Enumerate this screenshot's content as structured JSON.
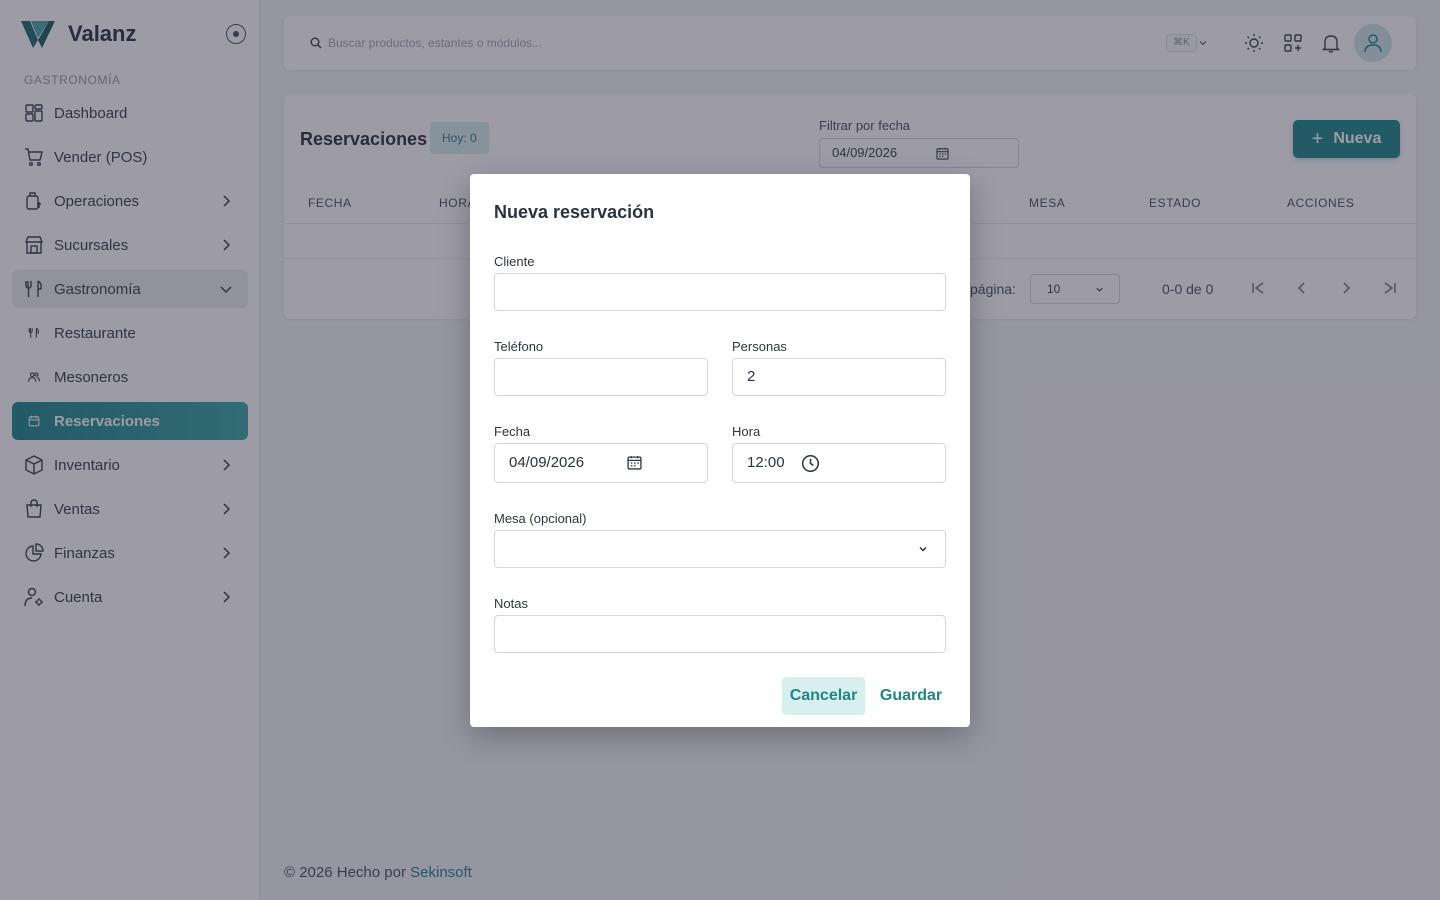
{
  "brand": {
    "name": "Valanz",
    "accent": "#1f8787"
  },
  "sidebar": {
    "section": "GASTRONOMÍA",
    "items": [
      {
        "label": "Dashboard",
        "icon": "dashboard-icon"
      },
      {
        "label": "Vender (POS)",
        "icon": "cart-icon"
      },
      {
        "label": "Operaciones",
        "icon": "operations-icon"
      },
      {
        "label": "Sucursales",
        "icon": "store-icon"
      },
      {
        "label": "Gastronomía",
        "icon": "fork-knife-icon"
      },
      {
        "label": "Restaurante",
        "icon": "fork-knife-icon"
      },
      {
        "label": "Mesoneros",
        "icon": "people-icon"
      },
      {
        "label": "Reservaciones",
        "icon": "calendar-icon"
      },
      {
        "label": "Inventario",
        "icon": "box-icon"
      },
      {
        "label": "Ventas",
        "icon": "bag-icon"
      },
      {
        "label": "Finanzas",
        "icon": "pie-chart-icon"
      },
      {
        "label": "Cuenta",
        "icon": "user-gear-icon"
      }
    ]
  },
  "topbar": {
    "search_placeholder": "Buscar productos, estantes o módulos...",
    "shortcut": "⌘K"
  },
  "page": {
    "title": "Reservaciones",
    "badge": "Hoy: 0",
    "filter_label": "Filtrar por fecha",
    "filter_value": "04/09/2026",
    "new_button": "Nueva",
    "columns": [
      "FECHA",
      "HORA",
      "MESA",
      "ESTADO",
      "ACCIONES"
    ],
    "rows_per_page_label": "página:",
    "rows_per_page": "10",
    "range": "0-0 de 0"
  },
  "footer": {
    "text": "© 2026 Hecho por ",
    "link": "Sekinsoft"
  },
  "modal": {
    "title": "Nueva reservación",
    "cliente_label": "Cliente",
    "cliente_value": "",
    "telefono_label": "Teléfono",
    "telefono_value": "",
    "personas_label": "Personas",
    "personas_value": "2",
    "fecha_label": "Fecha",
    "fecha_value": "04/09/2026",
    "hora_label": "Hora",
    "hora_value": "12:00",
    "mesa_label": "Mesa (opcional)",
    "mesa_value": "",
    "notas_label": "Notas",
    "notas_value": "",
    "cancel": "Cancelar",
    "save": "Guardar"
  }
}
